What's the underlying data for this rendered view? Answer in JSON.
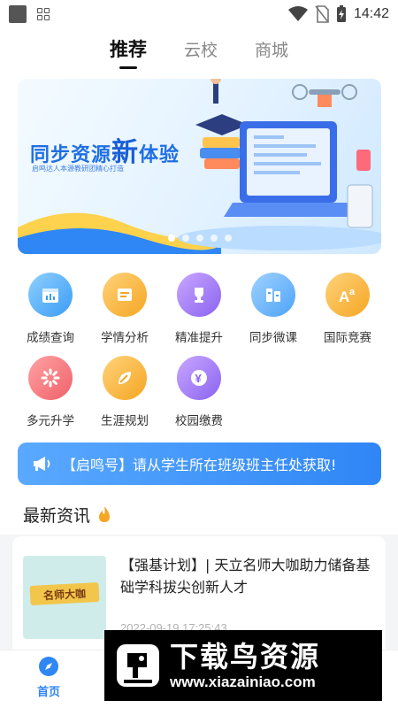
{
  "status_bar": {
    "time": "14:42"
  },
  "tabs": [
    {
      "label": "推荐",
      "active": true
    },
    {
      "label": "云校",
      "active": false
    },
    {
      "label": "商城",
      "active": false
    }
  ],
  "banner": {
    "title_part1": "同步资源",
    "title_big": "新",
    "title_part2": "体验",
    "subtitle": "启鸣达人本源教研团精心打造",
    "page_count": 5,
    "active_page": 1
  },
  "grid": [
    {
      "label": "成绩查询",
      "icon": "calendar-chart-icon",
      "color_from": "#8fd0ff",
      "color_to": "#3a9cf5"
    },
    {
      "label": "学情分析",
      "icon": "report-icon",
      "color_from": "#ffd27a",
      "color_to": "#f5a623"
    },
    {
      "label": "精准提升",
      "icon": "trophy-icon",
      "color_from": "#c9a7ff",
      "color_to": "#8a63f0"
    },
    {
      "label": "同步微课",
      "icon": "books-icon",
      "color_from": "#9fd2ff",
      "color_to": "#4ea3f7"
    },
    {
      "label": "国际竞赛",
      "icon": "letters-icon",
      "color_from": "#ffd27a",
      "color_to": "#f5a623"
    },
    {
      "label": "多元升学",
      "icon": "burst-icon",
      "color_from": "#ffa3a3",
      "color_to": "#f0606a"
    },
    {
      "label": "生涯规划",
      "icon": "leaf-icon",
      "color_from": "#ffd27a",
      "color_to": "#f5a623"
    },
    {
      "label": "校园缴费",
      "icon": "yuan-icon",
      "color_from": "#c9a7ff",
      "color_to": "#8a63f0"
    }
  ],
  "notice": {
    "text": "【启鸣号】请从学生所在班级班主任处获取!"
  },
  "news": {
    "header": "最新资讯",
    "items": [
      {
        "title": "【强基计划】| 天立名师大咖助力储备基础学科拔尖创新人才",
        "thumb_text": "名师大咖",
        "time": "2022-09-19 17:25:43"
      }
    ]
  },
  "bottom_nav": {
    "home_label": "首页"
  },
  "watermark": {
    "title": "下载鸟资源",
    "url": "www.xiazainiao.com"
  },
  "colors": {
    "accent": "#2f86f5",
    "brand_blue": "#1f6fe5"
  }
}
